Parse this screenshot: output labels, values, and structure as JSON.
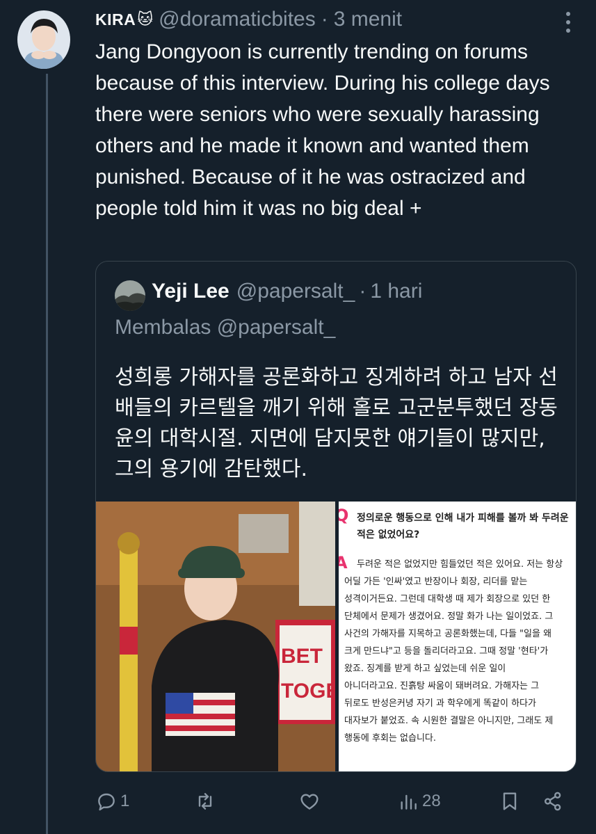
{
  "tweet": {
    "display_name": "KIRA",
    "name_emoji": "🐱",
    "handle": "@doramaticbites",
    "separator": "·",
    "time": "3 menit",
    "text": "Jang Dongyoon is currently trending on forums because of this interview. During his college days there were seniors who were sexually harassing others and he made it known and wanted them punished. Because of it he was ostracized and people told him it was no big deal +"
  },
  "quote": {
    "display_name": "Yeji Lee",
    "handle": "@papersalt_",
    "separator": "·",
    "time": "1 hari",
    "reply_to": "Membalas @papersalt_",
    "text": "성희롱 가해자를 공론화하고 징계하려 하고 남자 선배들의 카르텔을 깨기 위해 홀로 고군분투했던 장동윤의 대학시절. 지면에 담지못한 얘기들이 많지만, 그의 용기에 감탄했다.",
    "article": {
      "q_mark": "Q",
      "a_mark": "A",
      "question_lines": [
        "정의로운 행동으로 인해 내가 피해를 볼까 봐 두려운",
        "적은 없었어요?"
      ],
      "answer_lines": [
        "두려운 적은 없었지만 힘들었던 적은 있어요. 저는 항상",
        "어딜 가든 '인싸'였고 반장이나 회장, 리더를 맡는",
        "성격이거든요. 그런데 대학생 때 제가 회장으로 있던 한",
        "단체에서 문제가 생겼어요. 정말 화가 나는 일이었죠. 그",
        "사건의 가해자를 지목하고 공론화했는데, 다들 \"일을 왜",
        "크게 만드냐\"고 등을 돌리더라고요. 그때 정말 '현타'가",
        "왔죠. 징계를 받게 하고 싶었는데 쉬운 일이",
        "아니더라고요. 진흙탕 싸움이 돼버려요. 가해자는 그",
        "뒤로도 반성은커녕 자기 과 학우에게 똑같이 하다가",
        "대자보가 붙었죠. 속 시원한 결말은 아니지만, 그래도 제",
        "행동에 후회는 없습니다."
      ]
    },
    "photo_sign_text": [
      "BET",
      "TOGE"
    ]
  },
  "actions": {
    "reply_count": "1",
    "retweet_count": "",
    "like_count": "",
    "views_count": "28"
  },
  "colors": {
    "background": "#15202b",
    "text": "#f7f9f9",
    "secondary": "#8b98a5",
    "border": "#38444d"
  }
}
